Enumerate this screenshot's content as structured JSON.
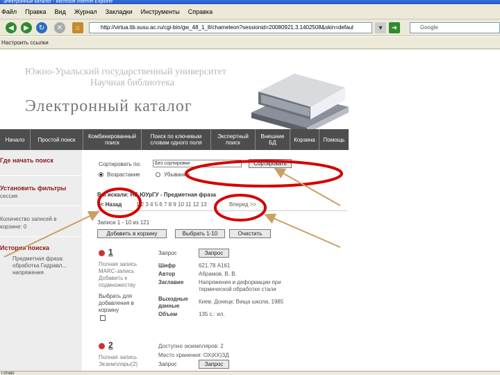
{
  "window": {
    "title": "Электронный каталог - Microsoft Internet Explorer"
  },
  "menu": [
    "Файл",
    "Правка",
    "Вид",
    "Журнал",
    "Закладки",
    "Инструменты",
    "Справка"
  ],
  "address": {
    "value": "http://virtua.lib.susu.ac.ru/cgi-bin/gw_48_1_8/chameleon?sessionid=20080921.3.1402508&skin=defaul"
  },
  "search_box": {
    "placeholder": "Google"
  },
  "links_bar": {
    "label": "Настроить ссылки"
  },
  "header": {
    "university_line1": "Южно-Уральский государственный университет",
    "university_line2": "Научная библиотека",
    "catalog_title": "Электронный каталог"
  },
  "top_nav": [
    {
      "label": "Начало"
    },
    {
      "label": "Простой поиск"
    },
    {
      "label": "Комбинированный поиск"
    },
    {
      "label": "Поиск по ключевым словам одного поля"
    },
    {
      "label": "Экспертный поиск"
    },
    {
      "label": "Внешние БД"
    },
    {
      "label": "Корзина"
    },
    {
      "label": "Помощь"
    }
  ],
  "sidebar": {
    "where_to_start": "Где начать поиск",
    "set_filters": "Установить фильтры",
    "session": "сессия",
    "records_count": "Количество записей в корзине: 0",
    "search_history": "История поиска",
    "history_note": "Предметная фраза: обработка Гидравл... напряжения"
  },
  "sort": {
    "label": "Сортировать по:",
    "selected": "Без сортировки",
    "button": "Сортировать",
    "ascending": "Возрастание",
    "descending": "Убывание"
  },
  "result": {
    "heading": "Вы искали: НБ ЮУрГУ - Предметная фраза",
    "back": "<< Назад",
    "pages": "1 2 3 4 5 6 7 8 9 10 11 12 13",
    "forward": "Вперед >>",
    "records_range": "Записи 1 - 10 из 121",
    "add_to_cart": "Добавить в корзину",
    "select_range": "Выбрать 1-10",
    "clear": "Очистить"
  },
  "records": [
    {
      "number": "1",
      "side_links": "Полная запись MARC-запись Добавить к подмножеству",
      "choose_label": "Выбрать для добавления в корзину",
      "request_label": "Запрос",
      "request_button": "Запрос",
      "fields": [
        {
          "key": "Шифр",
          "value": "621.78 А161"
        },
        {
          "key": "Автор",
          "value": "Абрамов, В. В."
        },
        {
          "key": "Заглавие",
          "value": "Напряжения и деформации при термической обработке стали"
        },
        {
          "key": "Выходные данные",
          "value": "Киев: Донецк: Вища школа, 1985"
        },
        {
          "key": "Объем",
          "value": "135 с.: ил."
        }
      ]
    },
    {
      "number": "2",
      "side_links": "Полная запись Экземпляры(2)",
      "availability": "Доступно экземпляров: 2",
      "location": "Место хранения: ОХ(КХ)ЗД",
      "request_label": "Запрос",
      "request_button": "Запрос"
    }
  ],
  "status": {
    "text": "Готово"
  },
  "colors": {
    "nav_bg": "#4d4d4d",
    "sidebar_bg": "#ededed",
    "heading_red": "#8b1a1a",
    "annotation_red": "#d40000",
    "chrome_bg": "#ece9d8"
  }
}
